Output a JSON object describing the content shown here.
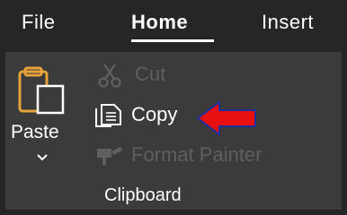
{
  "tabs": {
    "file": "File",
    "home": "Home",
    "insert": "Insert"
  },
  "clipboard": {
    "paste_label": "Paste",
    "cut_label": "Cut",
    "copy_label": "Copy",
    "format_painter_label": "Format Painter",
    "group_label": "Clipboard"
  },
  "icons": {
    "paste": "clipboard-icon",
    "cut": "scissors-icon",
    "copy": "copy-icon",
    "format_painter": "paintbrush-icon",
    "pointer": "red-arrow-icon"
  },
  "colors": {
    "pointer_arrow": "#e81010"
  }
}
